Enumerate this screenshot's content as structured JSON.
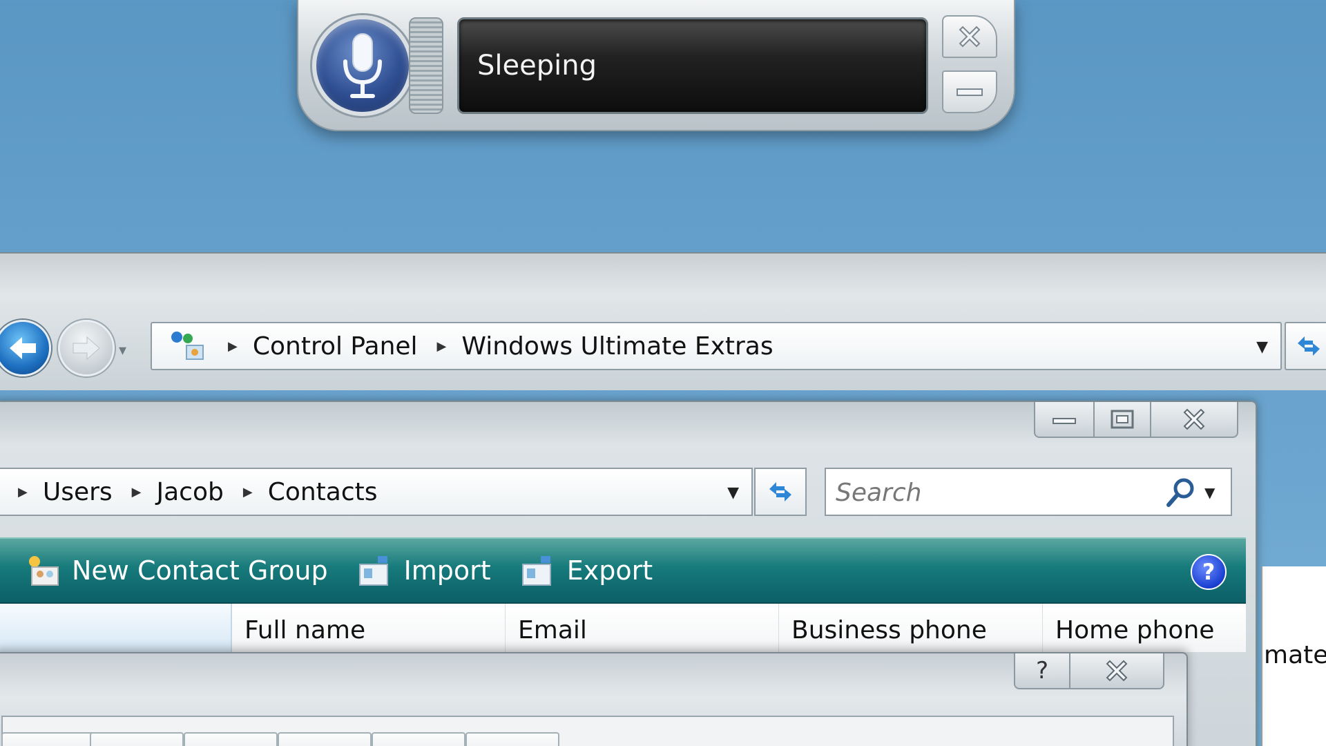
{
  "speech": {
    "status": "Sleeping"
  },
  "control_panel": {
    "breadcrumb": [
      "Control Panel",
      "Windows Ultimate Extras"
    ]
  },
  "contacts": {
    "breadcrumb": [
      "Users",
      "Jacob",
      "Contacts"
    ],
    "search": {
      "placeholder": "Search"
    },
    "toolbar": {
      "new_contact_group": "New Contact Group",
      "import": "Import",
      "export": "Export",
      "help": "?"
    },
    "columns": [
      "Full name",
      "Email",
      "Business phone",
      "Home phone"
    ]
  },
  "side_window": {
    "text_fragment": "mate"
  },
  "dialog": {
    "help": "?"
  },
  "colors": {
    "desktop": "#6ba5cf",
    "toolbar_teal": "#167a7b",
    "back_button": "#1d6fc0",
    "mic_blue": "#2f4f93"
  }
}
